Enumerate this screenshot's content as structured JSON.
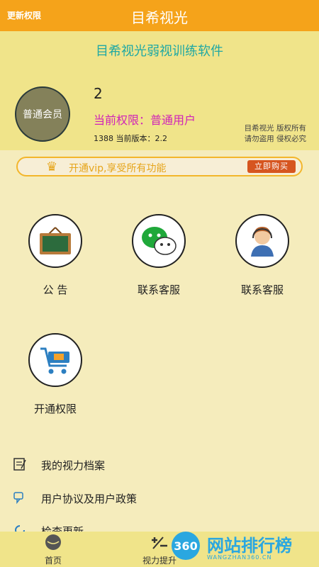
{
  "topbar": {
    "left_label": "更新权限",
    "title": "目希视光"
  },
  "header": {
    "app_name": "目希视光弱视训练软件",
    "avatar_label": "普通会员",
    "user_id": "2",
    "permission": "当前权限：普通用户",
    "version": "1388  当前版本：2.2",
    "copyright_line1": "目希视光  版权所有",
    "copyright_line2": "请勿盗用  侵权必究"
  },
  "vip": {
    "text": "开通vip,享受所有功能",
    "button": "立即购买"
  },
  "grid": [
    {
      "label": "公 告",
      "icon": "board-icon"
    },
    {
      "label": "联系客服",
      "icon": "wechat-icon"
    },
    {
      "label": "联系客服",
      "icon": "customer-service-icon"
    },
    {
      "label": "开通权限",
      "icon": "cart-icon"
    }
  ],
  "list": [
    {
      "label": "我的视力档案",
      "icon": "note-icon"
    },
    {
      "label": "用户协议及用户政策",
      "icon": "chat-icon"
    },
    {
      "label": "检查更新",
      "icon": "refresh-icon"
    }
  ],
  "tabs": [
    {
      "label": "首页",
      "icon": "home-icon"
    },
    {
      "label": "视力提升",
      "icon": "plus-minus-icon"
    }
  ],
  "watermark": {
    "badge": "360",
    "text": "网站排行榜",
    "sub": "WANGZHAN360.CN"
  },
  "colors": {
    "topbar": "#f5a31a",
    "accent": "#1fa8a4",
    "permission": "#d023b8",
    "vip": "#e6a51b"
  }
}
